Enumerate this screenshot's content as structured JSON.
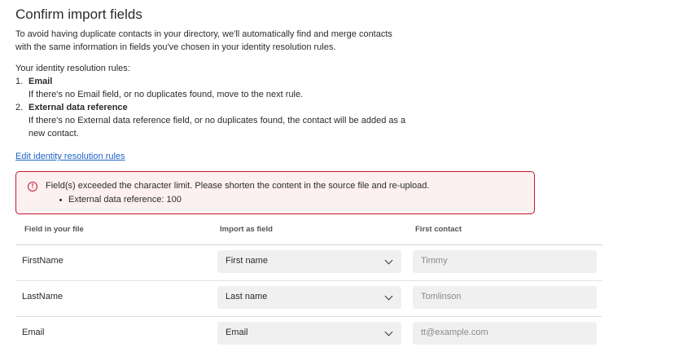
{
  "title": "Confirm import fields",
  "intro_line1": "To avoid having duplicate contacts in your directory, we'll automatically find and merge contacts",
  "intro_line2": "with the same information in fields you've chosen in your identity resolution rules.",
  "rules_heading": "Your identity resolution rules:",
  "rules": [
    {
      "number": "1.",
      "name": "Email",
      "description": "If there's no Email field, or no duplicates found, move to the next rule."
    },
    {
      "number": "2.",
      "name": "External data reference",
      "description": "If there's no External data reference field, or no duplicates found, the contact will be added as a new contact."
    }
  ],
  "edit_link": "Edit identity resolution rules",
  "error": {
    "icon": "alert-circle-icon",
    "message": "Field(s) exceeded the character limit. Please shorten the content in the source file and re-upload.",
    "items": [
      "External data reference: 100"
    ],
    "color": "#c0192c",
    "background": "#fdf0f1"
  },
  "table": {
    "headers": [
      "Field in your file",
      "Import as field",
      "First contact"
    ],
    "rows": [
      {
        "field": "FirstName",
        "import_as": "First name",
        "first_contact": "Timmy"
      },
      {
        "field": "LastName",
        "import_as": "Last name",
        "first_contact": "Tomlinson"
      },
      {
        "field": "Email",
        "import_as": "Email",
        "first_contact": "tt@example.com"
      }
    ]
  },
  "colors": {
    "link": "#1d64c8",
    "input_background": "#f0f0f0"
  }
}
